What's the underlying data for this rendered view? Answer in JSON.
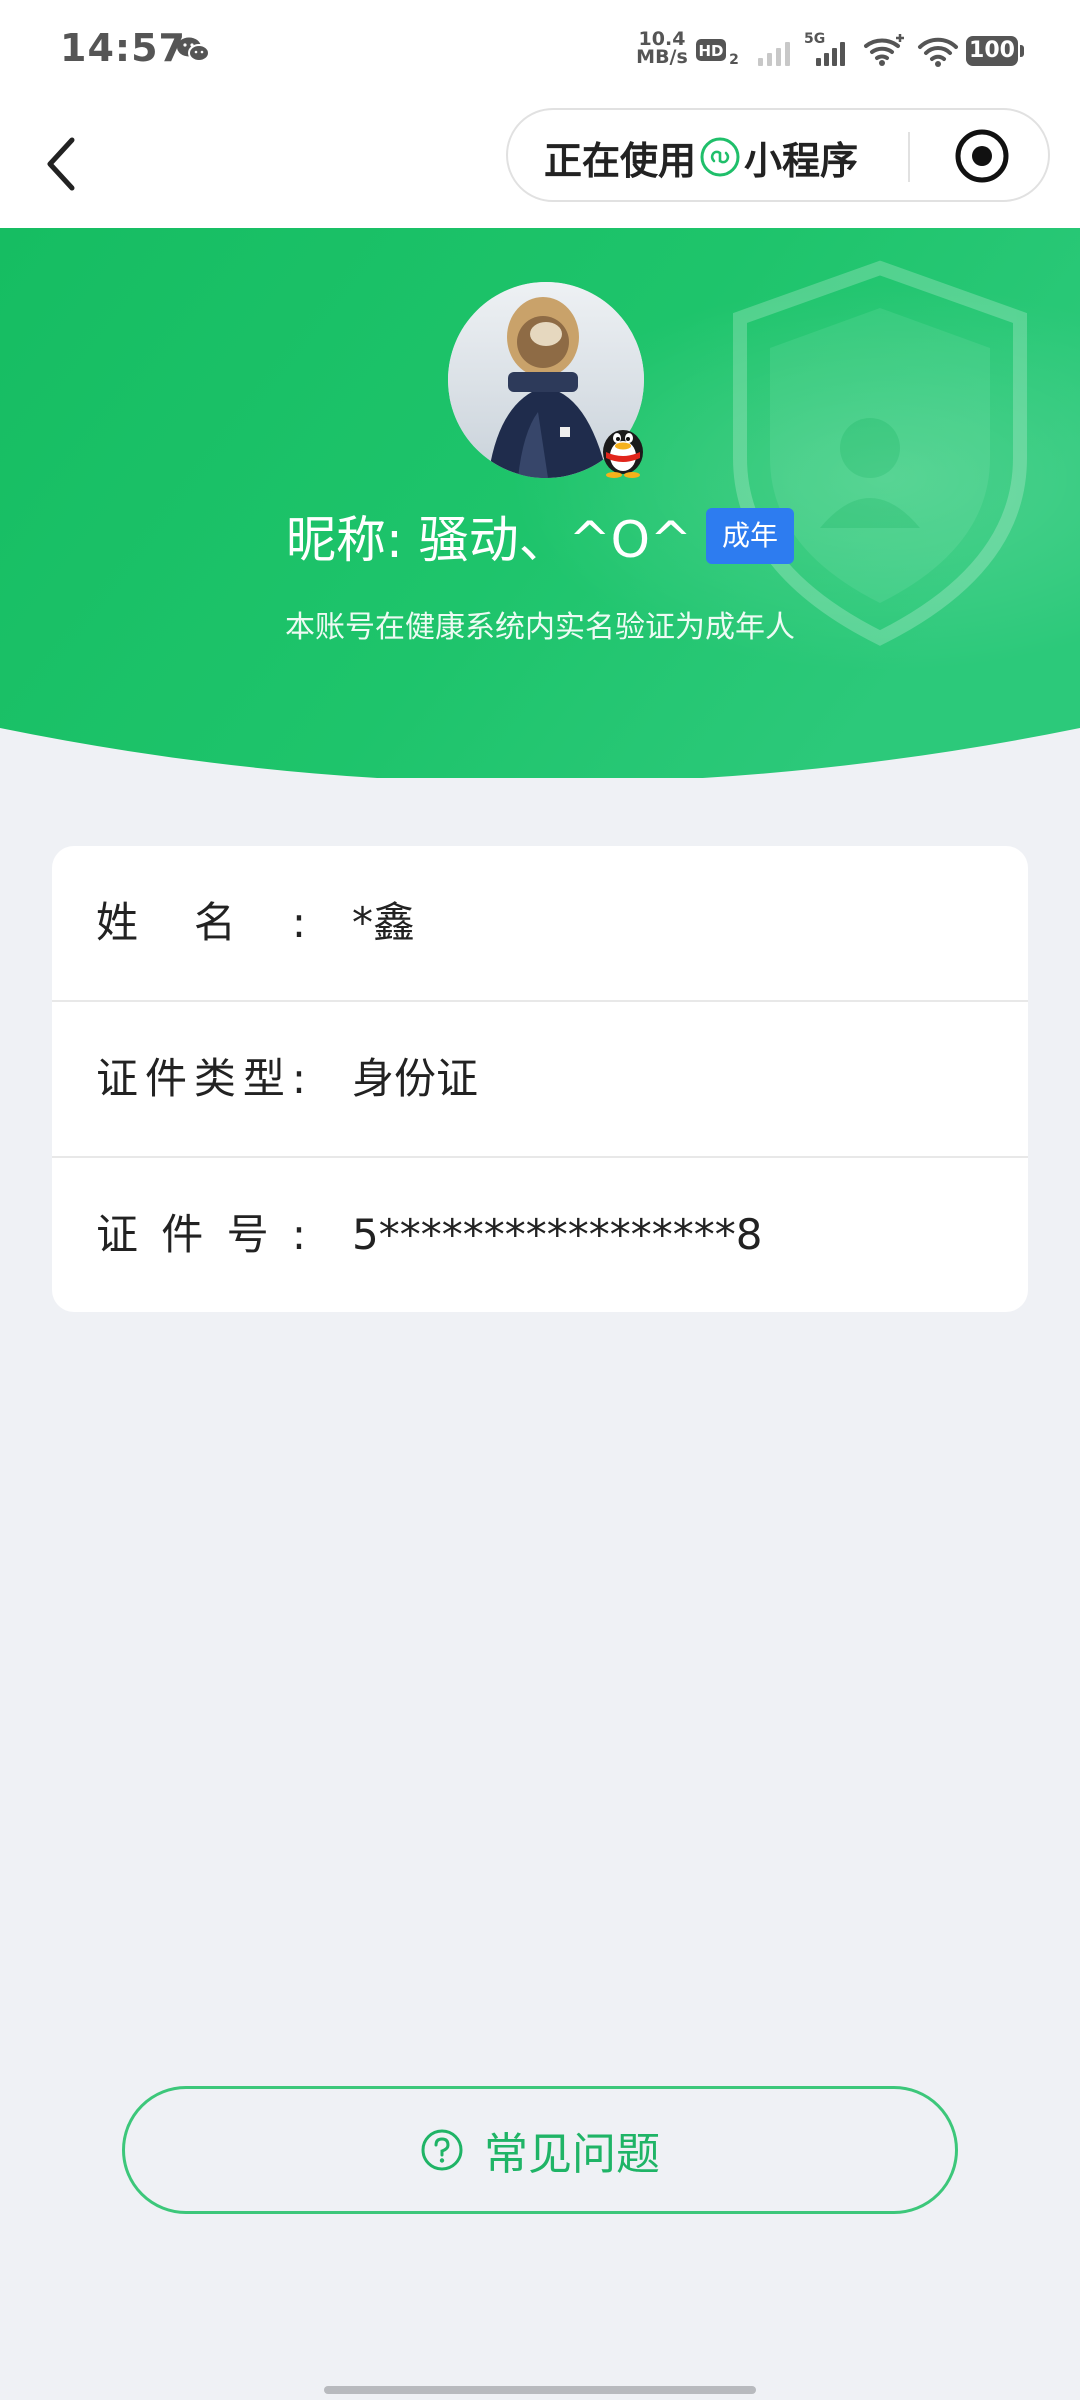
{
  "status_bar": {
    "time": "14:57",
    "net_speed_value": "10.4",
    "net_speed_unit": "MB/s",
    "hd_label": "HD",
    "hd_sub": "2",
    "signal_label": "5G",
    "battery": "100",
    "icons": [
      "wechat-icon",
      "hd-icon",
      "signal-icon",
      "wifi-icon",
      "battery-icon"
    ]
  },
  "nav": {
    "capsule_prefix": "正在使用",
    "capsule_suffix": "小程序",
    "icons": [
      "back-arrow-icon",
      "mini-program-link-icon",
      "record-circle-icon"
    ]
  },
  "profile": {
    "nickname": "昵称: 骚动、^O^",
    "badge": "成年",
    "verify_text": "本账号在健康系统内实名验证为成年人",
    "accent_color": "#1fbf6a",
    "badge_color": "#2d7cf0"
  },
  "info": {
    "rows": [
      {
        "label": "姓名:",
        "value": "*鑫"
      },
      {
        "label": "证件类型:",
        "value": "身份证"
      },
      {
        "label": "证件号:",
        "value": "5*****************8"
      }
    ]
  },
  "faq": {
    "label": "常见问题",
    "icon": "question-circle-icon"
  }
}
